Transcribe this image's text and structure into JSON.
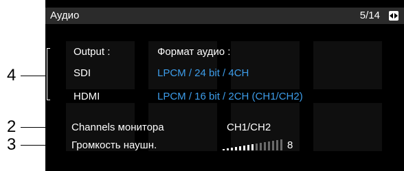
{
  "menu": {
    "title": "Аудио",
    "page": "5/14"
  },
  "output": {
    "label": "Output :",
    "format_header": "Формат аудио :",
    "sdi_label": "SDI",
    "sdi_value": "LPCM / 24 bit / 4CH",
    "hdmi_label": "HDMI",
    "hdmi_value": "LPCM / 16 bit / 2CH (CH1/CH2)"
  },
  "monitor": {
    "label": "Channels монитора",
    "value": "CH1/CH2"
  },
  "headphones": {
    "label": "Громкость наушн.",
    "value": "8",
    "level": 8,
    "max": 15
  },
  "callouts": {
    "c4": "4",
    "c2": "2",
    "c3": "3"
  },
  "colors": {
    "value_blue": "#3d9dea",
    "screen_bg": "#000000",
    "titlebar": "#2b2b2b"
  },
  "icons": {
    "nav": "left-right-arrows-icon"
  }
}
